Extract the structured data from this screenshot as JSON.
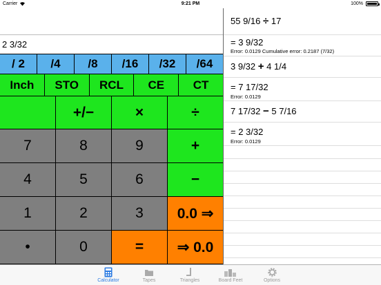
{
  "status_bar": {
    "carrier": "Carrier",
    "time": "9:21 PM",
    "battery": "100%"
  },
  "display": {
    "value": "2 3/32"
  },
  "fraction_keys": [
    "/ 2",
    "/4",
    "/8",
    "/16",
    "/32",
    "/64"
  ],
  "memory_keys": [
    "Inch",
    "STO",
    "RCL",
    "CE",
    "CT"
  ],
  "keypad": [
    {
      "label": "",
      "style": "g",
      "name": "blank-key"
    },
    {
      "label": "+/−",
      "style": "g",
      "name": "sign-toggle-key"
    },
    {
      "label": "×",
      "style": "g",
      "name": "multiply-key"
    },
    {
      "label": "÷",
      "style": "g",
      "name": "divide-key"
    },
    {
      "label": "7",
      "style": "gr",
      "name": "digit-7-key"
    },
    {
      "label": "8",
      "style": "gr",
      "name": "digit-8-key"
    },
    {
      "label": "9",
      "style": "gr",
      "name": "digit-9-key"
    },
    {
      "label": "+",
      "style": "g",
      "name": "add-key"
    },
    {
      "label": "4",
      "style": "gr",
      "name": "digit-4-key"
    },
    {
      "label": "5",
      "style": "gr",
      "name": "digit-5-key"
    },
    {
      "label": "6",
      "style": "gr",
      "name": "digit-6-key"
    },
    {
      "label": "−",
      "style": "g",
      "name": "subtract-key"
    },
    {
      "label": "1",
      "style": "gr",
      "name": "digit-1-key"
    },
    {
      "label": "2",
      "style": "gr",
      "name": "digit-2-key"
    },
    {
      "label": "3",
      "style": "gr",
      "name": "digit-3-key"
    },
    {
      "label": "0.0 ⇒",
      "style": "o",
      "name": "decimal-to-fraction-key"
    },
    {
      "label": "•",
      "style": "gr",
      "name": "decimal-point-key"
    },
    {
      "label": "0",
      "style": "gr",
      "name": "digit-0-key"
    },
    {
      "label": "=",
      "style": "o",
      "name": "equals-key"
    },
    {
      "label": "⇒ 0.0",
      "style": "o",
      "name": "fraction-to-decimal-key"
    }
  ],
  "tape": {
    "e1_expr_a": "55 9/16",
    "e1_op": "÷",
    "e1_expr_b": "17",
    "e1_result": "= 3 9/32",
    "e1_error": "Error: 0.0129  Cumulative error: 0.2187 (7/32)",
    "e2_expr_a": "3 9/32",
    "e2_op": "+",
    "e2_expr_b": "4 1/4",
    "e2_result": "= 7 17/32",
    "e2_error": "Error: 0.0129",
    "e3_expr_a": "7 17/32",
    "e3_op": "−",
    "e3_expr_b": "5 7/16",
    "e3_result": "= 2 3/32",
    "e3_error": "Error: 0.0129"
  },
  "tabs": {
    "calculator": "Calculator",
    "tapes": "Tapes",
    "triangles": "Triangles",
    "board_feet": "Board Feet",
    "options": "Options"
  },
  "colors": {
    "blue_keys": "#5ab1eb",
    "green_keys": "#1ee61e",
    "gray_keys": "#7f7f7f",
    "orange_keys": "#ff8000",
    "active_tab": "#2a7ae2"
  }
}
